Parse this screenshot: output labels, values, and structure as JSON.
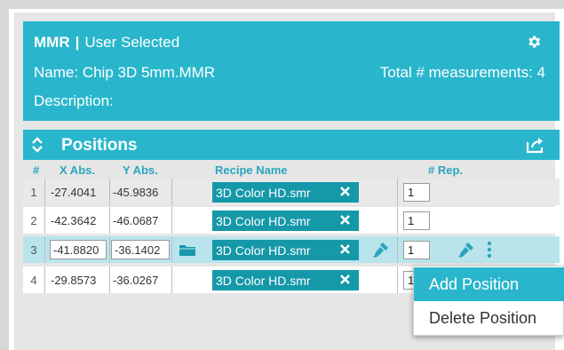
{
  "mmr": {
    "app_label": "MMR",
    "separator": "|",
    "status": "User Selected",
    "name_label": "Name:",
    "name_value": "Chip 3D 5mm.MMR",
    "total_label": "Total # measurements:",
    "total_value": "4",
    "description_label": "Description:"
  },
  "positions": {
    "title": "Positions"
  },
  "columns": {
    "index": "#",
    "x": "X Abs.",
    "y": "Y Abs.",
    "recipe": "Recipe Name",
    "rep": "# Rep."
  },
  "rows": [
    {
      "index": "1",
      "x": "-27.4041",
      "y": "-45.9836",
      "recipe": "3D Color HD.smr",
      "rep": "1"
    },
    {
      "index": "2",
      "x": "-42.3642",
      "y": "-46.0687",
      "recipe": "3D Color HD.smr",
      "rep": "1"
    },
    {
      "index": "3",
      "x": "-41.8820",
      "y": "-36.1402",
      "recipe": "3D Color HD.smr",
      "rep": "1"
    },
    {
      "index": "4",
      "x": "-29.8573",
      "y": "-36.0267",
      "recipe": "3D Color HD.smr",
      "rep": "1"
    }
  ],
  "context_menu": {
    "items": [
      "Add Position",
      "Delete Position"
    ],
    "highlighted": "Add Position"
  },
  "icons": [
    "gear-icon",
    "chevron-updown-icon",
    "share-icon",
    "close-icon",
    "folder-icon",
    "brush-icon",
    "kebab-menu-icon"
  ],
  "colors": {
    "accent": "#29b6cc",
    "recipe_chip": "#1598a8",
    "selected_row": "#b9e4ec",
    "header_text": "#2aa6bd"
  }
}
